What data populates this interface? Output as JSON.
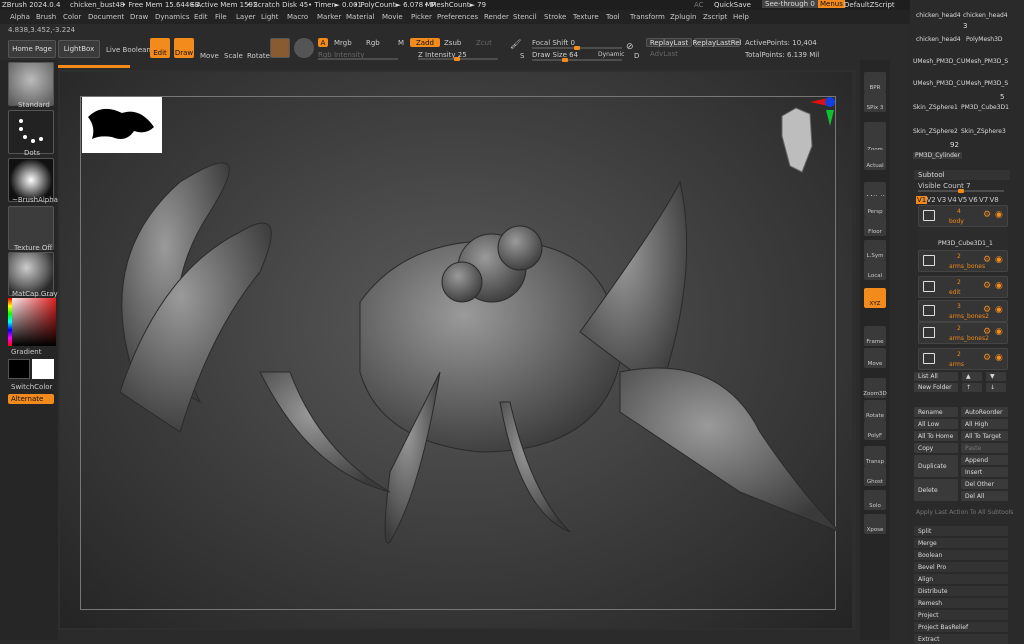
{
  "app": {
    "title": "ZBrush 2024.0.4",
    "doc": "chicken_bust48",
    "free_mem": "• Free Mem 15.644GB",
    "active_mem": "• Active Mem 1592",
    "scratch": "• Scratch Disk 45",
    "timer": "• Timer► 0.001",
    "polycount": "• PolyCount► 6.078 MP",
    "meshcount": "• MeshCount► 79",
    "ac": "AC",
    "quicksave": "QuickSave",
    "seethrough": "See-through",
    "seethrough_val": "0",
    "menus": "Menus",
    "defaultzscript": "DefaultZScript"
  },
  "menu": [
    "Alpha",
    "Brush",
    "Color",
    "Document",
    "Draw",
    "Dynamics",
    "Edit",
    "File",
    "Layer",
    "Light",
    "Macro",
    "Marker",
    "Material",
    "Movie",
    "Picker",
    "Preferences",
    "Render",
    "Stencil",
    "Stroke",
    "Texture",
    "Tool",
    "Transform",
    "Zplugin",
    "Zscript",
    "Help"
  ],
  "coords": "4.838,3.452,-3.224",
  "toolbar": {
    "home": "Home Page",
    "lightbox": "LightBox",
    "liveboolean": "Live Boolean",
    "edit": "Edit",
    "draw": "Draw",
    "move": "Move",
    "scale": "Scale",
    "rotate": "Rotate",
    "a": "A",
    "mrgb": "Mrgb",
    "rgb": "Rgb",
    "m": "M",
    "rgb_intensity": "Rgb Intensity",
    "zadd": "Zadd",
    "zsub": "Zsub",
    "zcut": "Zcut",
    "z_intensity": "Z Intensity",
    "z_intensity_val": "25",
    "focal": "Focal Shift",
    "focal_val": "0",
    "drawsize": "Draw Size",
    "drawsize_val": "64",
    "dynamic": "Dynamic",
    "replaylast": "ReplayLast",
    "replaylastrel": "ReplayLastRel",
    "advlast": "AdvLast",
    "activepoints": "ActivePoints: 10,404",
    "totalpoints": "TotalPoints: 6.139 Mil",
    "s_label": "S",
    "d_label": "D"
  },
  "leftshelf": {
    "standard": "Standard",
    "dots": "Dots",
    "brushalpha": "~BrushAlpha",
    "textureoff": "Texture Off",
    "matcap": "MatCap Gray",
    "gradient": "Gradient",
    "switchcolor": "SwitchColor",
    "alternate": "Alternate"
  },
  "rightshelf": [
    "BPR",
    "SPix 3",
    "Scroll",
    "Zoom",
    "Actual",
    "AAHalf",
    "Persp",
    "Floor",
    "L.Sym",
    "Local",
    "XYZ",
    "Frame",
    "Move",
    "Zoom3D",
    "Rotate",
    "PolyF",
    "Transp",
    "Ghost",
    "Solo",
    "Xpose"
  ],
  "tools": [
    {
      "name": "chicken_head4"
    },
    {
      "name": "chicken_head4"
    },
    {
      "name": "chicken_head4"
    },
    {
      "name": "PolyMesh3D"
    },
    {
      "name": "UMesh_PM3D_C"
    },
    {
      "name": "UMesh_PM3D_S"
    },
    {
      "name": "UMesh_PM3D_C"
    },
    {
      "name": "UMesh_PM3D_S"
    },
    {
      "name": "Skin_ZSphere1"
    },
    {
      "name": "PM3D_Cube3D1"
    },
    {
      "name": "Skin_ZSphere2"
    },
    {
      "name": "Skin_ZSphere3"
    },
    {
      "name": "PM3D_Cylinder"
    }
  ],
  "tool_counts": {
    "c3": "3",
    "c5": "5",
    "c92": "92"
  },
  "subtool": {
    "title": "Subtool",
    "visible": "Visible Count",
    "visible_val": "7",
    "versions": [
      "V1",
      "V2",
      "V3",
      "V4",
      "V5",
      "V6",
      "V7",
      "V8"
    ],
    "items": [
      {
        "name": "body",
        "count": "4"
      },
      {
        "name": "PM3D_Cube3D1_1",
        "count": ""
      },
      {
        "name": "arms_bones",
        "count": "2"
      },
      {
        "name": "edit",
        "count": "2"
      },
      {
        "name": "arms_bones2",
        "count": "3"
      },
      {
        "name": "arms_bones2",
        "count": "2"
      },
      {
        "name": "arms",
        "count": "2"
      }
    ],
    "listall": "List All",
    "newfolder": "New Folder",
    "rename": "Rename",
    "autoreorder": "AutoReorder",
    "alllow": "All Low",
    "allhigh": "All High",
    "alltohome": "All To Home",
    "alltotarget": "All To Target",
    "copy": "Copy",
    "paste": "Paste",
    "duplicate": "Duplicate",
    "append": "Append",
    "insert": "Insert",
    "delete": "Delete",
    "delother": "Del Other",
    "delall": "Del All",
    "applylast": "Apply Last Action To All Subtools"
  },
  "panels": [
    "Split",
    "Merge",
    "Boolean",
    "Bevel Pro",
    "Align",
    "Distribute",
    "Remesh",
    "Project",
    "Project BasRelief",
    "Extract"
  ],
  "colors": {
    "accent": "#f28a1c",
    "bg": "#2b2b2b"
  }
}
